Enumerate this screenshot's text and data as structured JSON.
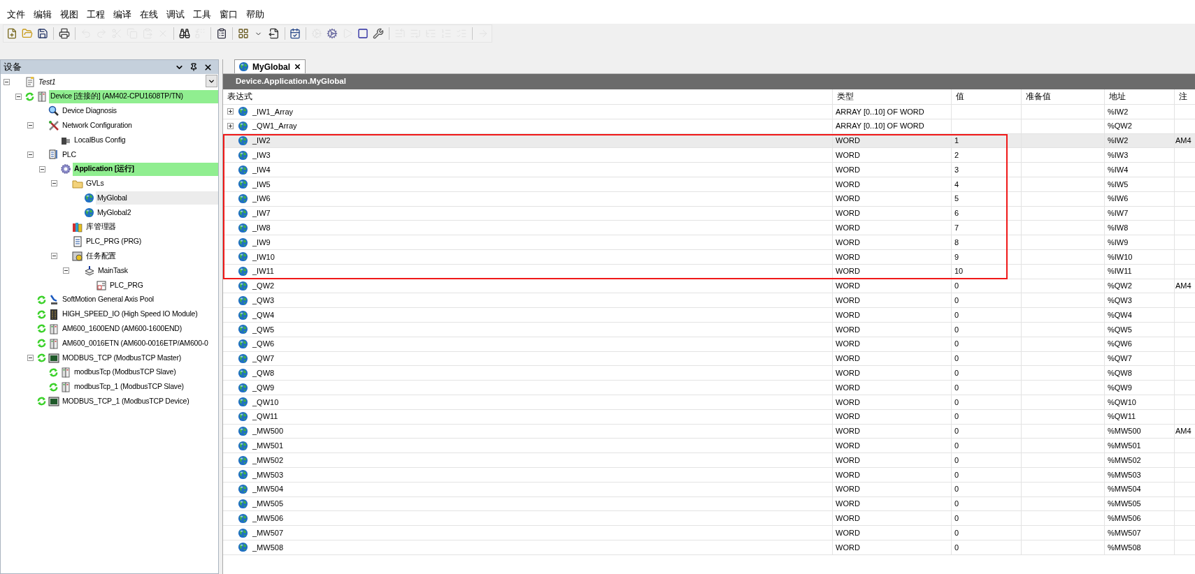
{
  "menu": [
    "文件",
    "编辑",
    "视图",
    "工程",
    "编译",
    "在线",
    "调试",
    "工具",
    "窗口",
    "帮助"
  ],
  "toolbar": [
    {
      "kind": "new",
      "disabled": false
    },
    {
      "kind": "open",
      "disabled": false
    },
    {
      "kind": "save",
      "disabled": false
    },
    {
      "kind": "separator"
    },
    {
      "kind": "print",
      "disabled": false
    },
    {
      "kind": "separator"
    },
    {
      "kind": "undo",
      "disabled": true
    },
    {
      "kind": "redo",
      "disabled": true
    },
    {
      "kind": "cut",
      "disabled": true
    },
    {
      "kind": "copy",
      "disabled": true
    },
    {
      "kind": "paste",
      "disabled": true
    },
    {
      "kind": "delete",
      "disabled": true
    },
    {
      "kind": "separator"
    },
    {
      "kind": "find",
      "disabled": false
    },
    {
      "kind": "replace",
      "disabled": true
    },
    {
      "kind": "separator"
    },
    {
      "kind": "clipboard",
      "disabled": false
    },
    {
      "kind": "separator"
    },
    {
      "kind": "add-object",
      "disabled": false
    },
    {
      "kind": "dropdown",
      "disabled": false
    },
    {
      "kind": "export",
      "disabled": false
    },
    {
      "kind": "separator"
    },
    {
      "kind": "build",
      "disabled": false
    },
    {
      "kind": "separator"
    },
    {
      "kind": "login",
      "disabled": true
    },
    {
      "kind": "logout",
      "disabled": false
    },
    {
      "kind": "start",
      "disabled": true
    },
    {
      "kind": "stop",
      "disabled": false
    },
    {
      "kind": "wrench",
      "disabled": false
    },
    {
      "kind": "separator"
    },
    {
      "kind": "step-over",
      "disabled": true
    },
    {
      "kind": "step-into",
      "disabled": true
    },
    {
      "kind": "step-out",
      "disabled": true
    },
    {
      "kind": "run-to",
      "disabled": true
    },
    {
      "kind": "set-next",
      "disabled": true
    },
    {
      "kind": "separator"
    },
    {
      "kind": "show-next",
      "disabled": true
    }
  ],
  "devices_panel": {
    "title": "设备",
    "tree": [
      {
        "label": "Test1",
        "kind": "project",
        "online": false,
        "highlighted": false,
        "selected": false,
        "expanded": true,
        "children": [
          {
            "label": "Device [连接的] (AM402-CPU1608TP/TN)",
            "kind": "device",
            "online": true,
            "highlighted": true,
            "selected": false,
            "expanded": true,
            "children": [
              {
                "label": "Device Diagnosis",
                "kind": "diagnosis",
                "online": false,
                "highlighted": false,
                "selected": false
              },
              {
                "label": "Network Configuration",
                "kind": "network",
                "online": false,
                "highlighted": false,
                "selected": false,
                "expanded": true,
                "children": [
                  {
                    "label": "LocalBus Config",
                    "kind": "localbus",
                    "online": false,
                    "highlighted": false,
                    "selected": false
                  }
                ]
              },
              {
                "label": "PLC",
                "kind": "plc",
                "online": false,
                "highlighted": false,
                "selected": false,
                "expanded": true,
                "children": [
                  {
                    "label": "Application [运行]",
                    "kind": "application",
                    "online": false,
                    "highlighted": true,
                    "selected": false,
                    "expanded": true,
                    "children": [
                      {
                        "label": "GVLs",
                        "kind": "folder",
                        "online": false,
                        "highlighted": false,
                        "selected": false,
                        "expanded": true,
                        "children": [
                          {
                            "label": "MyGlobal",
                            "kind": "gvl",
                            "online": false,
                            "highlighted": false,
                            "selected": true
                          },
                          {
                            "label": "MyGlobal2",
                            "kind": "gvl",
                            "online": false,
                            "highlighted": false,
                            "selected": false
                          }
                        ]
                      },
                      {
                        "label": "库管理器",
                        "kind": "library",
                        "online": false,
                        "highlighted": false,
                        "selected": false
                      },
                      {
                        "label": "PLC_PRG (PRG)",
                        "kind": "pou",
                        "online": false,
                        "highlighted": false,
                        "selected": false
                      },
                      {
                        "label": "任务配置",
                        "kind": "task-config",
                        "online": false,
                        "highlighted": false,
                        "selected": false,
                        "expanded": true,
                        "children": [
                          {
                            "label": "MainTask",
                            "kind": "task",
                            "online": false,
                            "highlighted": false,
                            "selected": false,
                            "expanded": true,
                            "children": [
                              {
                                "label": "PLC_PRG",
                                "kind": "program-call",
                                "online": false,
                                "highlighted": false,
                                "selected": false
                              }
                            ]
                          }
                        ]
                      }
                    ]
                  }
                ]
              },
              {
                "label": "SoftMotion General Axis Pool",
                "kind": "softmotion",
                "online": true,
                "highlighted": false,
                "selected": false
              },
              {
                "label": "HIGH_SPEED_IO (High Speed IO Module)",
                "kind": "io-module",
                "online": true,
                "highlighted": false,
                "selected": false
              },
              {
                "label": "AM600_1600END (AM600-1600END)",
                "kind": "module",
                "online": true,
                "highlighted": false,
                "selected": false
              },
              {
                "label": "AM600_0016ETN (AM600-0016ETP/AM600-0",
                "kind": "module",
                "online": true,
                "highlighted": false,
                "selected": false
              },
              {
                "label": "MODBUS_TCP (ModbusTCP Master)",
                "kind": "ethernet",
                "online": true,
                "highlighted": false,
                "selected": false,
                "expanded": true,
                "children": [
                  {
                    "label": "modbusTcp (ModbusTCP Slave)",
                    "kind": "module",
                    "online": true,
                    "highlighted": false,
                    "selected": false
                  },
                  {
                    "label": "modbusTcp_1 (ModbusTCP Slave)",
                    "kind": "module",
                    "online": true,
                    "highlighted": false,
                    "selected": false
                  }
                ]
              },
              {
                "label": "MODBUS_TCP_1 (ModbusTCP Device)",
                "kind": "ethernet",
                "online": true,
                "highlighted": false,
                "selected": false
              }
            ]
          }
        ]
      }
    ]
  },
  "editor": {
    "tab": {
      "label": "MyGlobal",
      "selected": true
    },
    "path": "Device.Application.MyGlobal",
    "columns": [
      "表达式",
      "类型",
      "值",
      "准备值",
      "地址",
      "注"
    ],
    "rows": [
      {
        "name": "_IW1_Array",
        "type": "ARRAY [0..10] OF WORD",
        "address": "%IW2",
        "expanded": false,
        "selected": false,
        "highlighted": false
      },
      {
        "name": "_QW1_Array",
        "type": "ARRAY [0..10] OF WORD",
        "address": "%QW2",
        "expanded": false,
        "selected": false,
        "highlighted": false
      },
      {
        "name": "_IW2",
        "type": "WORD",
        "value": "1",
        "address": "%IW2",
        "comment": "AM4",
        "selected": true,
        "highlighted": true
      },
      {
        "name": "_IW3",
        "type": "WORD",
        "value": "2",
        "address": "%IW3",
        "selected": false,
        "highlighted": true
      },
      {
        "name": "_IW4",
        "type": "WORD",
        "value": "3",
        "address": "%IW4",
        "selected": false,
        "highlighted": true
      },
      {
        "name": "_IW5",
        "type": "WORD",
        "value": "4",
        "address": "%IW5",
        "selected": false,
        "highlighted": true
      },
      {
        "name": "_IW6",
        "type": "WORD",
        "value": "5",
        "address": "%IW6",
        "selected": false,
        "highlighted": true
      },
      {
        "name": "_IW7",
        "type": "WORD",
        "value": "6",
        "address": "%IW7",
        "selected": false,
        "highlighted": true
      },
      {
        "name": "_IW8",
        "type": "WORD",
        "value": "7",
        "address": "%IW8",
        "selected": false,
        "highlighted": true
      },
      {
        "name": "_IW9",
        "type": "WORD",
        "value": "8",
        "address": "%IW9",
        "selected": false,
        "highlighted": true
      },
      {
        "name": "_IW10",
        "type": "WORD",
        "value": "9",
        "address": "%IW10",
        "selected": false,
        "highlighted": true
      },
      {
        "name": "_IW11",
        "type": "WORD",
        "value": "10",
        "address": "%IW11",
        "selected": false,
        "highlighted": true
      },
      {
        "name": "_QW2",
        "type": "WORD",
        "value": "0",
        "address": "%QW2",
        "comment": "AM4",
        "selected": false,
        "highlighted": false
      },
      {
        "name": "_QW3",
        "type": "WORD",
        "value": "0",
        "address": "%QW3",
        "selected": false,
        "highlighted": false
      },
      {
        "name": "_QW4",
        "type": "WORD",
        "value": "0",
        "address": "%QW4",
        "selected": false,
        "highlighted": false
      },
      {
        "name": "_QW5",
        "type": "WORD",
        "value": "0",
        "address": "%QW5",
        "selected": false,
        "highlighted": false
      },
      {
        "name": "_QW6",
        "type": "WORD",
        "value": "0",
        "address": "%QW6",
        "selected": false,
        "highlighted": false
      },
      {
        "name": "_QW7",
        "type": "WORD",
        "value": "0",
        "address": "%QW7",
        "selected": false,
        "highlighted": false
      },
      {
        "name": "_QW8",
        "type": "WORD",
        "value": "0",
        "address": "%QW8",
        "selected": false,
        "highlighted": false
      },
      {
        "name": "_QW9",
        "type": "WORD",
        "value": "0",
        "address": "%QW9",
        "selected": false,
        "highlighted": false
      },
      {
        "name": "_QW10",
        "type": "WORD",
        "value": "0",
        "address": "%QW10",
        "selected": false,
        "highlighted": false
      },
      {
        "name": "_QW11",
        "type": "WORD",
        "value": "0",
        "address": "%QW11",
        "selected": false,
        "highlighted": false
      },
      {
        "name": "_MW500",
        "type": "WORD",
        "value": "0",
        "address": "%MW500",
        "comment": "AM4",
        "selected": false,
        "highlighted": false
      },
      {
        "name": "_MW501",
        "type": "WORD",
        "value": "0",
        "address": "%MW501",
        "selected": false,
        "highlighted": false
      },
      {
        "name": "_MW502",
        "type": "WORD",
        "value": "0",
        "address": "%MW502",
        "selected": false,
        "highlighted": false
      },
      {
        "name": "_MW503",
        "type": "WORD",
        "value": "0",
        "address": "%MW503",
        "selected": false,
        "highlighted": false
      },
      {
        "name": "_MW504",
        "type": "WORD",
        "value": "0",
        "address": "%MW504",
        "selected": false,
        "highlighted": false
      },
      {
        "name": "_MW505",
        "type": "WORD",
        "value": "0",
        "address": "%MW505",
        "selected": false,
        "highlighted": false
      },
      {
        "name": "_MW506",
        "type": "WORD",
        "value": "0",
        "address": "%MW506",
        "selected": false,
        "highlighted": false
      },
      {
        "name": "_MW507",
        "type": "WORD",
        "value": "0",
        "address": "%MW507",
        "selected": false,
        "highlighted": false
      },
      {
        "name": "_MW508",
        "type": "WORD",
        "value": "0",
        "address": "%MW508",
        "selected": false,
        "highlighted": false
      }
    ]
  }
}
